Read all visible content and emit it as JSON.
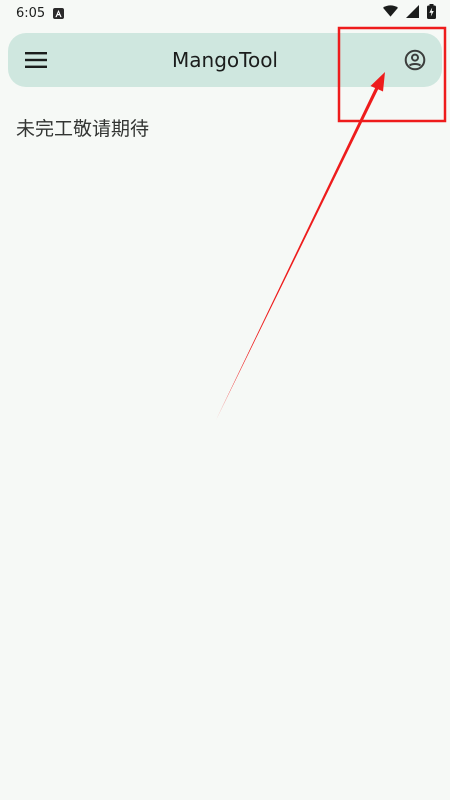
{
  "status_bar": {
    "time": "6:05",
    "notification_icon": "android-a-icon",
    "icons": [
      "wifi-icon",
      "signal-icon",
      "battery-charging-icon"
    ]
  },
  "app_bar": {
    "title": "MangoTool",
    "left_icon": "menu-icon",
    "right_icon": "account-circle-icon",
    "background": "#cfe7df"
  },
  "main": {
    "message": "未完工敬请期待"
  },
  "annotation": {
    "color": "#ee1c1c",
    "shapes": [
      "highlight-box",
      "arrow"
    ]
  }
}
